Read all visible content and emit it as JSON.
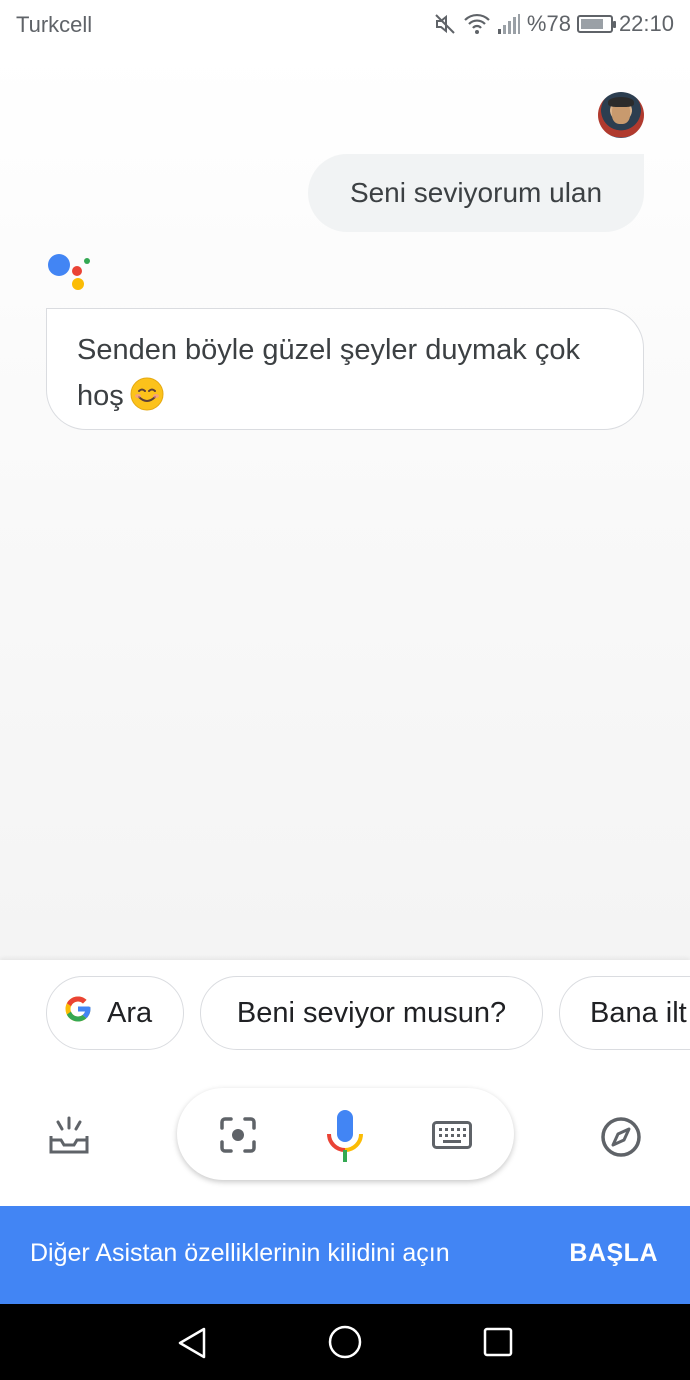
{
  "status_bar": {
    "carrier": "Turkcell",
    "battery": "%78",
    "battery_level": 0.78,
    "time": "22:10"
  },
  "conversation": {
    "user_message": "Seni seviyorum ulan",
    "assistant_message": "Senden böyle güzel şeyler duymak çok hoş",
    "assistant_emoji": "smiling-face-emoji"
  },
  "suggestions": [
    {
      "label": "Ara",
      "icon": "google-g-icon"
    },
    {
      "label": "Beni seviyor musun?"
    },
    {
      "label": "Bana ilt"
    }
  ],
  "controls": {
    "left_icon": "updates-tray-icon",
    "lens_icon": "lens-icon",
    "mic_icon": "microphone-icon",
    "keyboard_icon": "keyboard-icon",
    "right_icon": "explore-compass-icon"
  },
  "banner": {
    "text": "Diğer Asistan özelliklerinin kilidini açın",
    "button": "BAŞLA"
  },
  "colors": {
    "blue": "#4285f4",
    "red": "#ea4335",
    "yellow": "#fbbc05",
    "green": "#34a853"
  }
}
